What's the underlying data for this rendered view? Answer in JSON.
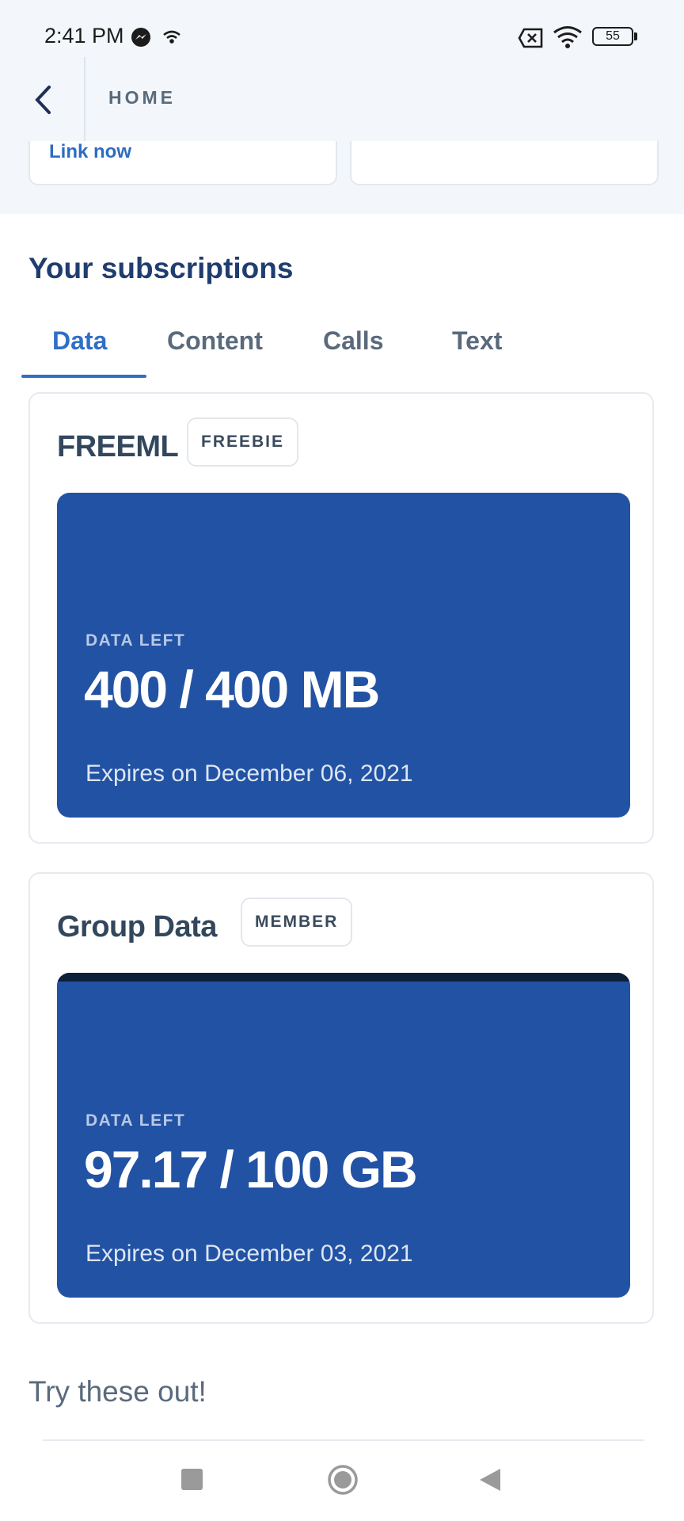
{
  "status_bar": {
    "time": "2:41 PM",
    "battery": "55",
    "icons": [
      "messenger-icon",
      "hotspot-icon",
      "sim-off-icon",
      "wifi-icon",
      "battery-icon"
    ]
  },
  "header": {
    "title": "HOME"
  },
  "top_cards": {
    "link_label": "Link now"
  },
  "subscriptions": {
    "title": "Your subscriptions",
    "tabs": [
      {
        "label": "Data",
        "active": true
      },
      {
        "label": "Content",
        "active": false
      },
      {
        "label": "Calls",
        "active": false
      },
      {
        "label": "Text",
        "active": false
      }
    ],
    "cards": [
      {
        "name": "FREEML",
        "badge": "FREEBIE",
        "data_left_label": "DATA LEFT",
        "amount": "400 / 400 MB",
        "expires": "Expires on December 06, 2021"
      },
      {
        "name": "Group Data",
        "badge": "MEMBER",
        "data_left_label": "DATA LEFT",
        "amount": "97.17 / 100 GB",
        "expires": "Expires on December 03, 2021"
      }
    ]
  },
  "try_section": {
    "title": "Try these out!"
  },
  "colors": {
    "brand_blue": "#2252a3",
    "accent_blue": "#2f6fc6",
    "heading_navy": "#1f3d6f"
  }
}
